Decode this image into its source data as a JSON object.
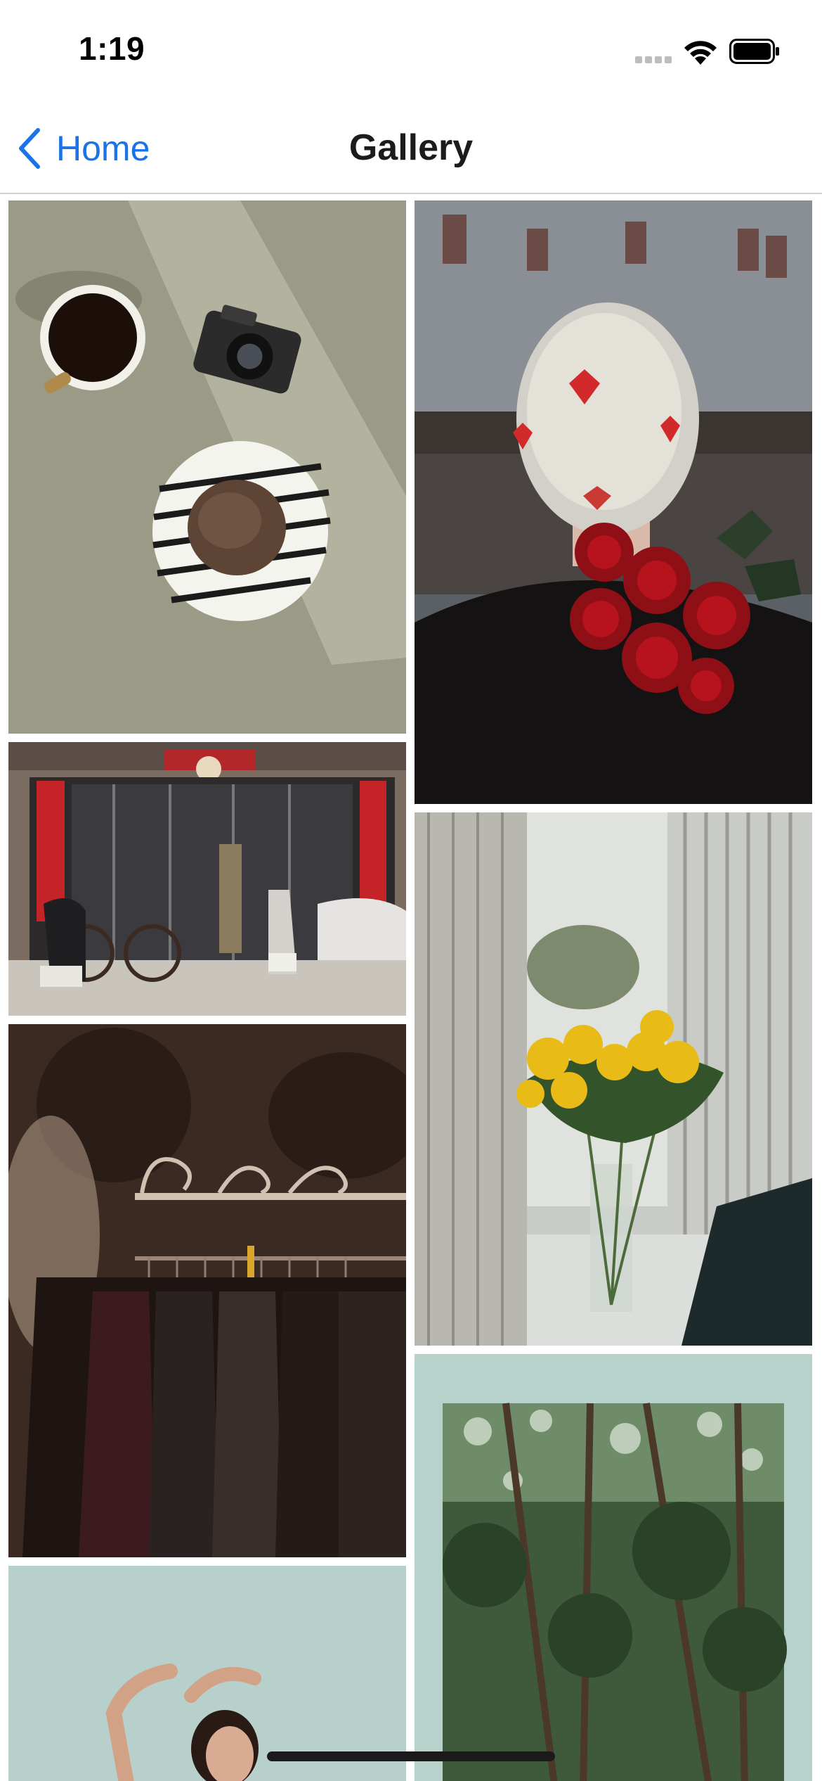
{
  "status_bar": {
    "time": "1:19"
  },
  "nav": {
    "back_label": "Home",
    "title": "Gallery"
  },
  "gallery": {
    "photos": [
      {
        "name": "coffee-camera-cookie-photo"
      },
      {
        "name": "hair-with-roses-photo"
      },
      {
        "name": "storefront-scooters-photo"
      },
      {
        "name": "yellow-roses-window-photo"
      },
      {
        "name": "clothing-rack-photo"
      },
      {
        "name": "framed-forest-photo"
      },
      {
        "name": "woman-pose-photo"
      }
    ]
  },
  "colors": {
    "accent": "#1a73e8",
    "title": "#1c1c1e",
    "divider": "#d1d1d6"
  }
}
